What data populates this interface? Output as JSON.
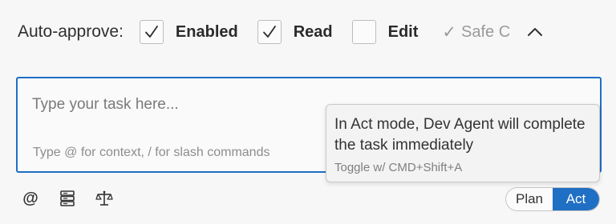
{
  "auto_approve": {
    "label": "Auto-approve:",
    "options": [
      {
        "label": "Enabled",
        "checked": true
      },
      {
        "label": "Read",
        "checked": true
      },
      {
        "label": "Edit",
        "checked": false
      }
    ],
    "safe_label": "Safe C",
    "safe_check": "✓"
  },
  "task_input": {
    "placeholder": "Type your task here...",
    "hint": "Type @ for context, / for slash commands"
  },
  "tooltip": {
    "message": "In Act mode, Dev Agent will complete the task immediately",
    "shortcut": "Toggle w/ CMD+Shift+A"
  },
  "toolbar": {
    "at_symbol": "@",
    "icons": [
      "at-icon",
      "server-icon",
      "scale-icon"
    ]
  },
  "mode_toggle": {
    "plan_label": "Plan",
    "act_label": "Act",
    "active": "act"
  },
  "colors": {
    "accent": "#1f6fc4",
    "background": "#f7f7f7"
  }
}
